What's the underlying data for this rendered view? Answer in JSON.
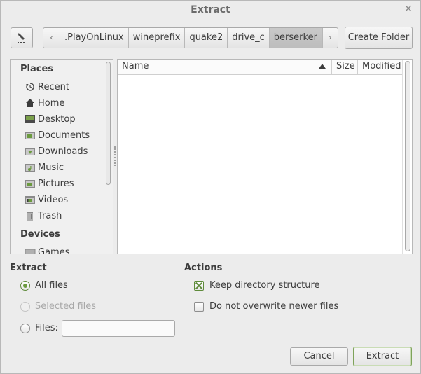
{
  "window": {
    "title": "Extract"
  },
  "toolbar": {
    "path": [
      ".PlayOnLinux",
      "wineprefix",
      "quake2",
      "drive_c",
      "berserker"
    ],
    "active_index": 4,
    "create_folder_label": "Create Folder"
  },
  "places": {
    "heading": "Places",
    "items": [
      {
        "label": "Recent",
        "icon": "recent-icon"
      },
      {
        "label": "Home",
        "icon": "home-icon"
      },
      {
        "label": "Desktop",
        "icon": "desktop-icon"
      },
      {
        "label": "Documents",
        "icon": "documents-folder-icon"
      },
      {
        "label": "Downloads",
        "icon": "downloads-folder-icon"
      },
      {
        "label": "Music",
        "icon": "music-folder-icon"
      },
      {
        "label": "Pictures",
        "icon": "pictures-folder-icon"
      },
      {
        "label": "Videos",
        "icon": "videos-folder-icon"
      },
      {
        "label": "Trash",
        "icon": "trash-icon"
      }
    ],
    "devices_heading": "Devices",
    "devices": [
      {
        "label": "Games",
        "icon": "drive-icon"
      }
    ]
  },
  "filelist": {
    "columns": {
      "name": "Name",
      "size": "Size",
      "modified": "Modified"
    },
    "rows": []
  },
  "extract": {
    "heading": "Extract",
    "all_files": "All files",
    "selected_files": "Selected files",
    "files": "Files:",
    "files_value": ""
  },
  "actions": {
    "heading": "Actions",
    "keep_structure": "Keep directory structure",
    "no_overwrite": "Do not overwrite newer files"
  },
  "buttons": {
    "cancel": "Cancel",
    "extract": "Extract"
  },
  "colors": {
    "accent": "#6b9a3f",
    "background": "#ececec"
  }
}
